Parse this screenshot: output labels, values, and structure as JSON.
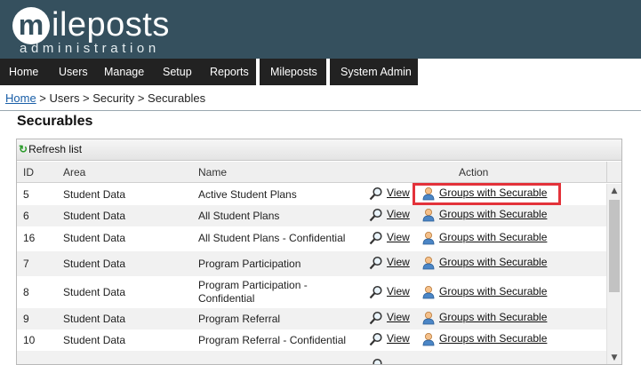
{
  "logo": {
    "mark": "m",
    "word": "ileposts",
    "subtitle": "administration"
  },
  "nav": {
    "main": [
      "Home",
      "Users",
      "Manage",
      "Setup",
      "Reports"
    ],
    "mileposts": "Mileposts",
    "system_admin": "System Admin"
  },
  "breadcrumb": {
    "home": "Home",
    "rest": " > Users > Security > Securables"
  },
  "page_title": "Securables",
  "toolbar": {
    "refresh_label": "Refresh list"
  },
  "table": {
    "columns": {
      "id": "ID",
      "area": "Area",
      "name": "Name",
      "action": "Action"
    },
    "view_label": "View",
    "groups_label": "Groups with Securable",
    "rows": [
      {
        "id": "5",
        "area": "Student Data",
        "name": "Active Student Plans"
      },
      {
        "id": "6",
        "area": "Student Data",
        "name": "All Student Plans"
      },
      {
        "id": "16",
        "area": "Student Data",
        "name": "All Student Plans - Confidential"
      },
      {
        "id": "7",
        "area": "Student Data",
        "name": "Program Participation"
      },
      {
        "id": "8",
        "area": "Student Data",
        "name_line1": "Program Participation -",
        "name_line2": "Confidential"
      },
      {
        "id": "9",
        "area": "Student Data",
        "name": "Program Referral"
      },
      {
        "id": "10",
        "area": "Student Data",
        "name": "Program Referral - Confidential"
      }
    ]
  },
  "colors": {
    "header_bg": "#35505e",
    "nav_bg": "#222222",
    "highlight": "#e3323a",
    "link": "#1a5fa8"
  }
}
